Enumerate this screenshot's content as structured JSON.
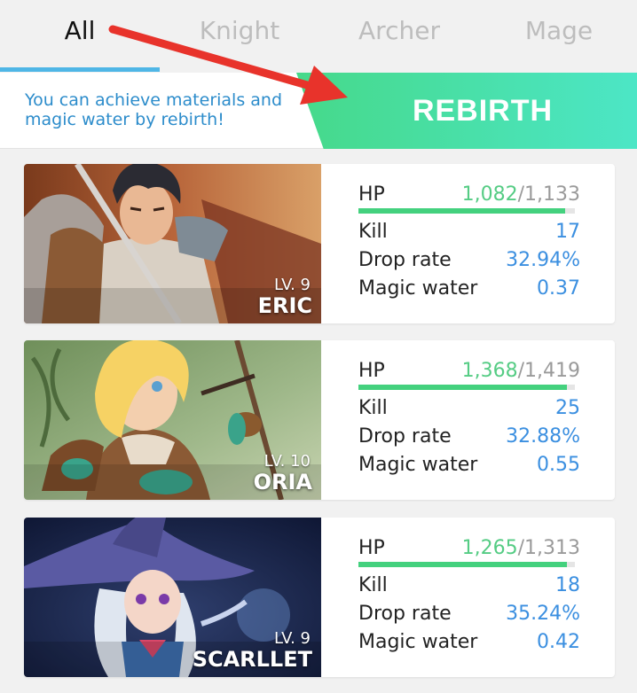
{
  "tabs": [
    {
      "label": "All",
      "active": true
    },
    {
      "label": "Knight",
      "active": false
    },
    {
      "label": "Archer",
      "active": false
    },
    {
      "label": "Mage",
      "active": false
    }
  ],
  "banner": {
    "message": "You can achieve materials and magic water by rebirth!",
    "rebirth_label": "REBIRTH"
  },
  "labels": {
    "hp": "HP",
    "kill": "Kill",
    "drop_rate": "Drop rate",
    "magic_water": "Magic water"
  },
  "heroes": [
    {
      "name": "ERIC",
      "level": "LV. 9",
      "hp_current": "1,082",
      "hp_max": "/1,133",
      "hp_fraction": 0.955,
      "kill": "17",
      "drop_rate": "32.94%",
      "magic_water": "0.37"
    },
    {
      "name": "ORIA",
      "level": "LV. 10",
      "hp_current": "1,368",
      "hp_max": "/1,419",
      "hp_fraction": 0.964,
      "kill": "25",
      "drop_rate": "32.88%",
      "magic_water": "0.55"
    },
    {
      "name": "SCARLLET",
      "level": "LV. 9",
      "hp_current": "1,265",
      "hp_max": "/1,313",
      "hp_fraction": 0.963,
      "kill": "18",
      "drop_rate": "35.24%",
      "magic_water": "0.42"
    }
  ],
  "colors": {
    "accent_blue": "#2c8ccb",
    "rebirth_green": "#46d98a",
    "hp_green": "#44d17e",
    "value_blue": "#3b8fe0",
    "arrow_red": "#e8332b"
  }
}
